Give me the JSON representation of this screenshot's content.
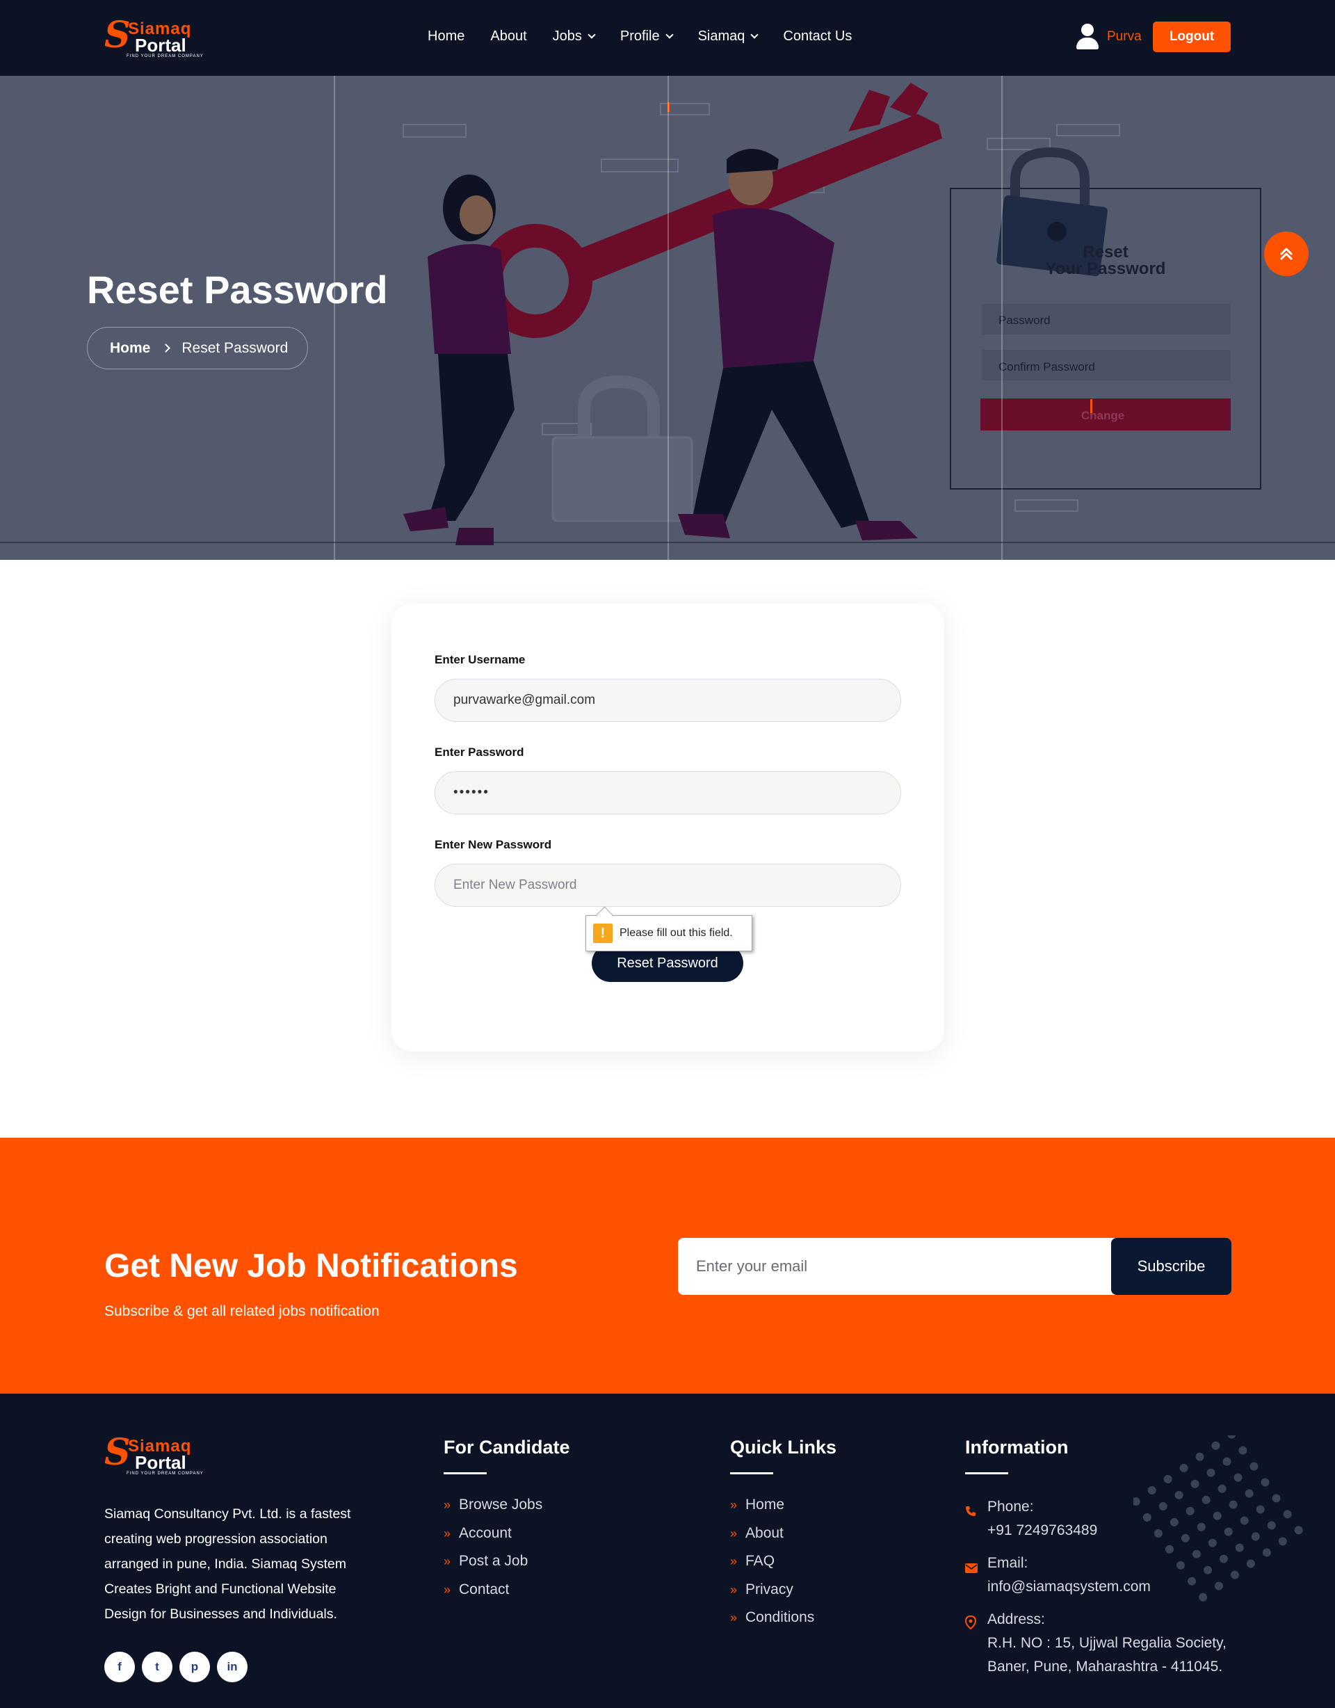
{
  "header": {
    "logo": {
      "brand_top": "Siamaq",
      "brand_bottom": "Portal",
      "tagline": "FIND YOUR DREAM COMPANY"
    },
    "nav": [
      {
        "label": "Home",
        "dropdown": false
      },
      {
        "label": "About",
        "dropdown": false
      },
      {
        "label": "Jobs",
        "dropdown": true
      },
      {
        "label": "Profile",
        "dropdown": true
      },
      {
        "label": "Siamaq",
        "dropdown": true
      },
      {
        "label": "Contact Us",
        "dropdown": false
      }
    ],
    "user_name": "Purva",
    "logout_label": "Logout"
  },
  "hero": {
    "title": "Reset Password",
    "breadcrumb": {
      "home": "Home",
      "current": "Reset Password"
    },
    "illustration": {
      "panel_title_line1": "Reset",
      "panel_title_line2": "Your Password",
      "password_placeholder": "Password",
      "confirm_placeholder": "Confirm Password",
      "change_label": "Change"
    }
  },
  "form": {
    "username_label": "Enter Username",
    "username_value": "purvawarke@gmail.com",
    "password_label": "Enter Password",
    "password_value": "••••••",
    "new_password_label": "Enter New Password",
    "new_password_placeholder": "Enter New Password",
    "validation_message": "Please fill out this field.",
    "submit_label": "Reset Password"
  },
  "newsletter": {
    "title": "Get New Job Notifications",
    "subtitle": "Subscribe & get all related jobs notification",
    "email_placeholder": "Enter your email",
    "subscribe_label": "Subscribe"
  },
  "footer": {
    "about": "Siamaq Consultancy Pvt. Ltd. is a fastest creating web progression association arranged in pune, India. Siamaq System Creates Bright and Functional Website Design for Businesses and Individuals.",
    "socials": [
      {
        "icon": "facebook-icon",
        "glyph": "f"
      },
      {
        "icon": "twitter-icon",
        "glyph": "t"
      },
      {
        "icon": "pinterest-icon",
        "glyph": "p"
      },
      {
        "icon": "linkedin-icon",
        "glyph": "in"
      }
    ],
    "candidate": {
      "title": "For Candidate",
      "links": [
        "Browse Jobs",
        "Account",
        "Post a Job",
        "Contact"
      ]
    },
    "quick_links": {
      "title": "Quick Links",
      "links": [
        "Home",
        "About",
        "FAQ",
        "Privacy",
        "Conditions"
      ]
    },
    "information": {
      "title": "Information",
      "phone_label": "Phone:",
      "phone": "+91 7249763489",
      "email_label": "Email:",
      "email": "info@siamaqsystem.com",
      "address_label": "Address:",
      "address_line1": "R.H. NO : 15, Ujjwal Regalia Society,",
      "address_line2": "Baner, Pune, Maharashtra - 411045."
    }
  },
  "colors": {
    "accent": "#ff5200",
    "navy": "#0b1325",
    "hero_overlay": "#545a6e"
  }
}
